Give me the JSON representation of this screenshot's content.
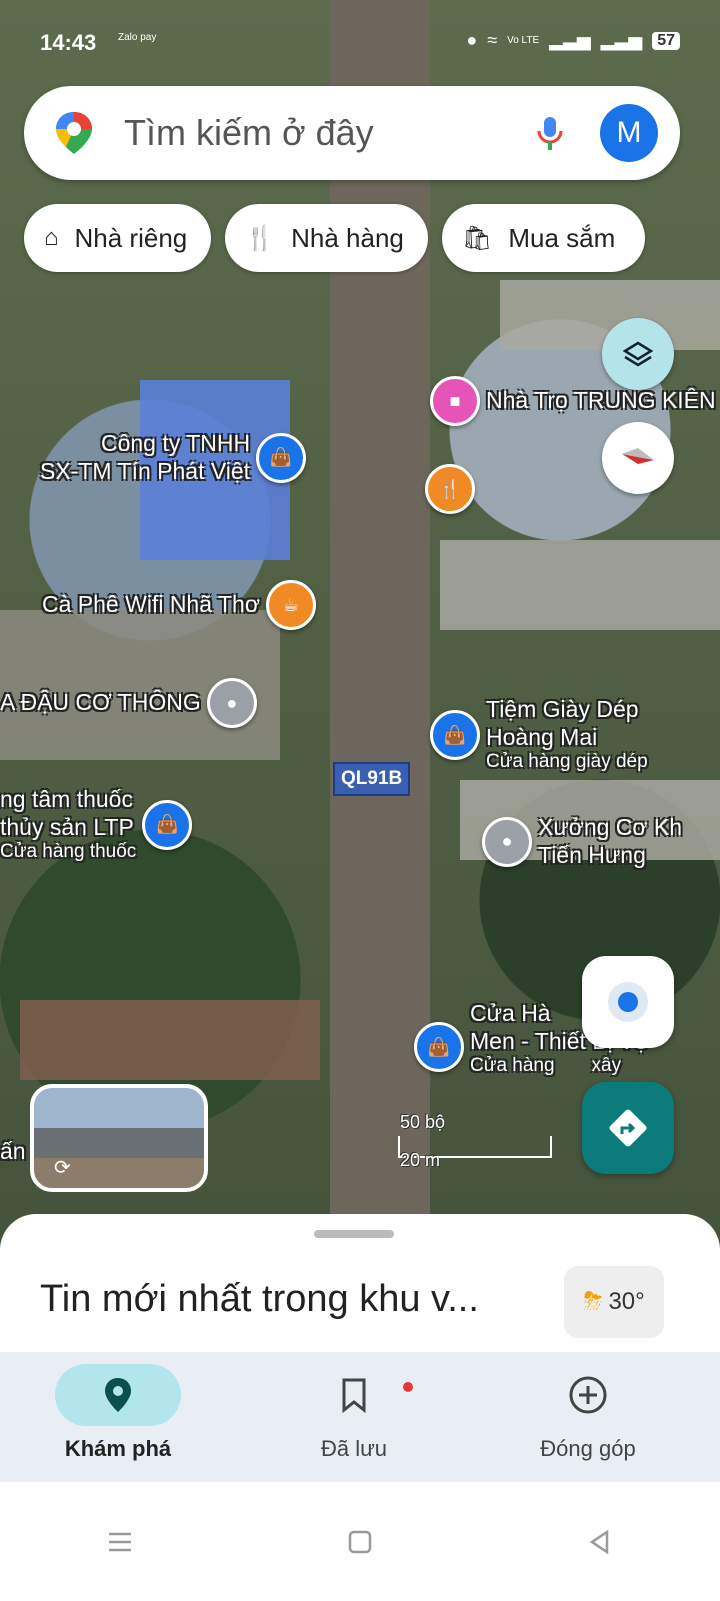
{
  "status_bar": {
    "time": "14:43",
    "zalo_pay": "Zalo pay",
    "volte": "Vo LTE",
    "battery": "57"
  },
  "search": {
    "placeholder": "Tìm kiếm ở đây",
    "avatar_letter": "M"
  },
  "chips": [
    {
      "label": "Nhà riêng",
      "icon": "home-icon"
    },
    {
      "label": "Nhà hàng",
      "icon": "restaurant-icon"
    },
    {
      "label": "Mua sắm",
      "icon": "shopping-bag-icon"
    }
  ],
  "map": {
    "road_label": "QL91B",
    "pois": [
      {
        "name": "Nhà Trọ TRUNG KIÊN",
        "icon": "bed-icon"
      },
      {
        "name": "Công ty TNHH\nSX-TM Tín Phát Việt",
        "icon": "shopping-bag-icon"
      },
      {
        "name": "",
        "icon": "restaurant-icon"
      },
      {
        "name": "Cà Phê Wifi Nhã Thơ",
        "icon": "coffee-icon"
      },
      {
        "name": "A ĐẬU CƠ THÔNG",
        "icon": "place-icon"
      },
      {
        "name": "Tiệm Giày Dép\nHoàng Mai",
        "sub": "Cửa hàng giày dép",
        "icon": "shopping-bag-icon"
      },
      {
        "name": "ng tâm thuốc\nthủy sản LTP",
        "sub": "Cửa hàng thuốc",
        "icon": "shopping-bag-icon"
      },
      {
        "name": "Xưởng Cơ Kh\nTiến Hưng",
        "icon": "place-icon"
      },
      {
        "name": "Cửa Hà      h\nMen - Thiết Bị Vệ",
        "sub": "Cửa hàng       xây",
        "icon": "shopping-bag-icon"
      },
      {
        "name": "ấn",
        "icon": ""
      }
    ],
    "scale_feet": "50 bộ",
    "scale_meters": "20 m"
  },
  "sheet": {
    "title": "Tin mới nhất trong khu v...",
    "weather_temp": "30°"
  },
  "bottom_nav": [
    {
      "label": "Khám phá",
      "icon": "explore-pin-icon",
      "active": true
    },
    {
      "label": "Đã lưu",
      "icon": "bookmark-icon",
      "active": false
    },
    {
      "label": "Đóng góp",
      "icon": "add-circle-icon",
      "active": false
    }
  ],
  "colors": {
    "accent_blue": "#1a73e8",
    "directions_teal": "#0b7a7a",
    "nav_active_pill": "#b3e5ec"
  }
}
